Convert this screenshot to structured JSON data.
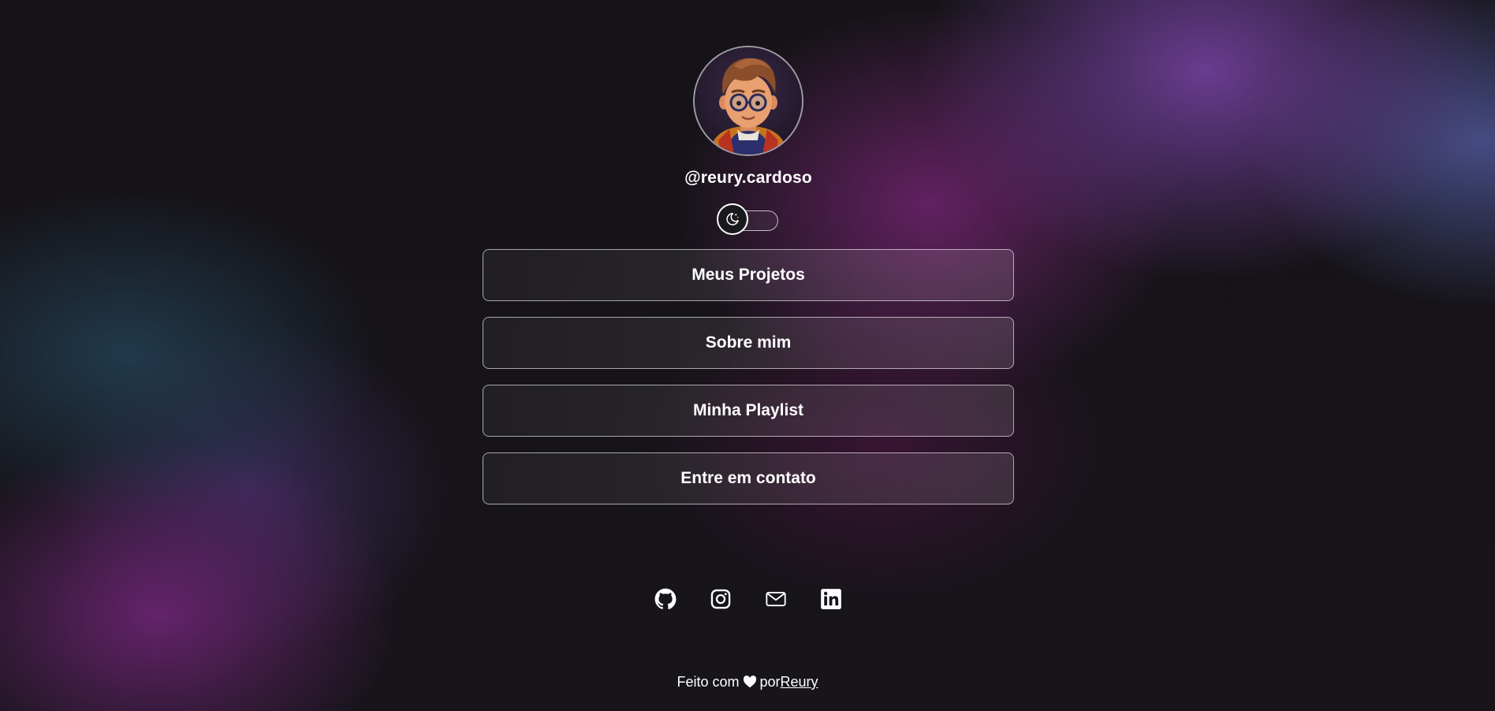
{
  "profile": {
    "username": "@reury.cardoso",
    "avatar_icon": "avatar-illustration"
  },
  "theme_toggle": {
    "icon": "moon-stars-icon",
    "state": "dark"
  },
  "links": [
    {
      "label": "Meus Projetos"
    },
    {
      "label": "Sobre mim"
    },
    {
      "label": "Minha Playlist"
    },
    {
      "label": "Entre em contato"
    }
  ],
  "socials": [
    {
      "icon": "github-icon"
    },
    {
      "icon": "instagram-icon"
    },
    {
      "icon": "mail-icon"
    },
    {
      "icon": "linkedin-icon"
    }
  ],
  "footer": {
    "prefix": "Feito com",
    "by": "por",
    "author": "Reury"
  }
}
